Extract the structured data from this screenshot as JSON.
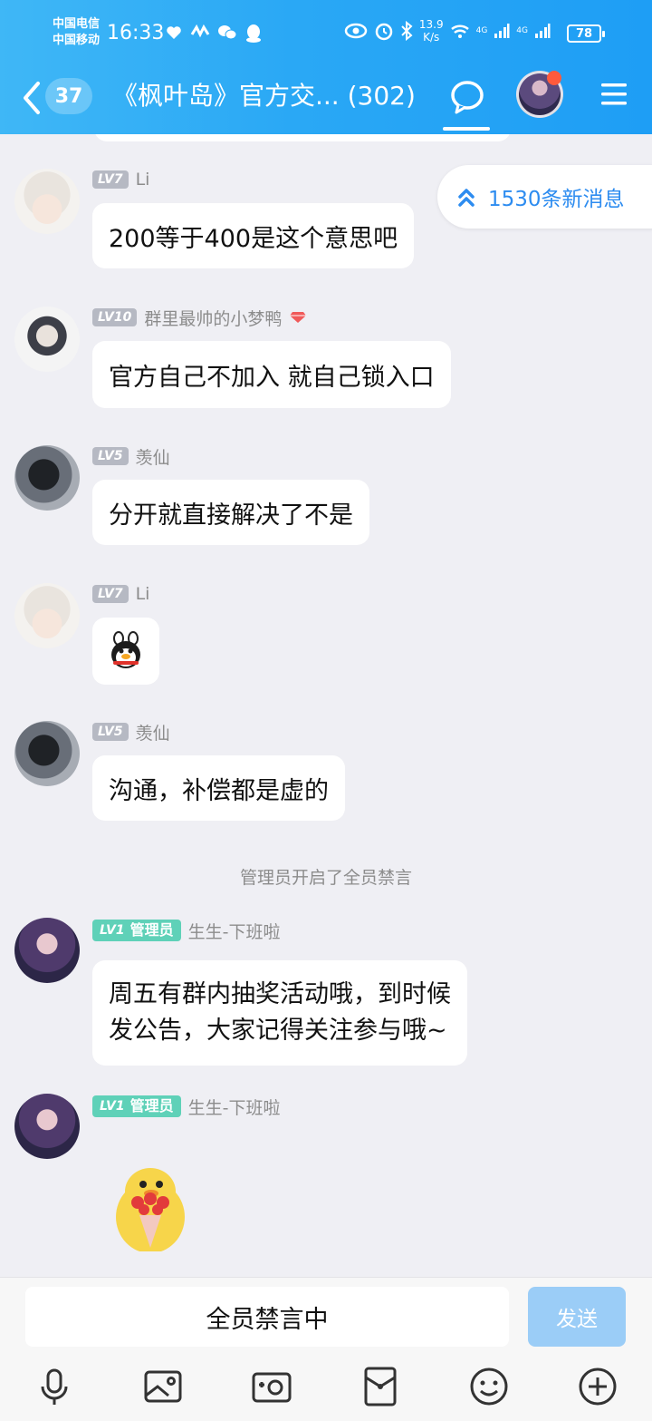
{
  "status_bar": {
    "carrier_1": "中国电信",
    "carrier_2": "中国移动",
    "time": "16:33",
    "net_speed_value": "13.9",
    "net_speed_unit": "K/s",
    "network_1": "4G",
    "network_2": "4G",
    "battery": "78"
  },
  "header": {
    "unread_count": "37",
    "title": "《枫叶岛》官方交...",
    "member_count": "(302)"
  },
  "new_messages_pill": "1530条新消息",
  "messages": [
    {
      "level": "LV7",
      "name": "Li",
      "text": "200等于400是这个意思吧"
    },
    {
      "level": "LV10",
      "name": "群里最帅的小梦鸭",
      "text": "官方自己不加入 就自己锁入口"
    },
    {
      "level": "LV5",
      "name": "羡仙",
      "text": "分开就直接解决了不是"
    },
    {
      "level": "LV7",
      "name": "Li",
      "emoji": "qq-penguin-emoji"
    },
    {
      "level": "LV5",
      "name": "羡仙",
      "text": "沟通，补偿都是虚的"
    },
    {
      "system": "管理员开启了全员禁言"
    },
    {
      "level": "LV1",
      "role": "管理员",
      "name": "生生-下班啦",
      "text_line1": "周五有群内抽奖活动哦，到时候",
      "text_line2": "发公告，大家记得关注参与哦~"
    },
    {
      "level": "LV1",
      "role": "管理员",
      "name": "生生-下班啦",
      "sticker": "duck-with-flowers-sticker"
    }
  ],
  "input": {
    "muted_text": "全员禁言中",
    "send_label": "发送"
  },
  "colors": {
    "header_start": "#3fb7f6",
    "header_end": "#1e9ef5",
    "accent": "#2d8cf0",
    "admin_badge": "#5fd1b8",
    "send_disabled": "#9bcdf7",
    "chat_bg": "#efeff4"
  },
  "toolbar_icons": [
    "microphone-icon",
    "image-icon",
    "camera-icon",
    "red-packet-icon",
    "emoji-icon",
    "plus-icon"
  ]
}
